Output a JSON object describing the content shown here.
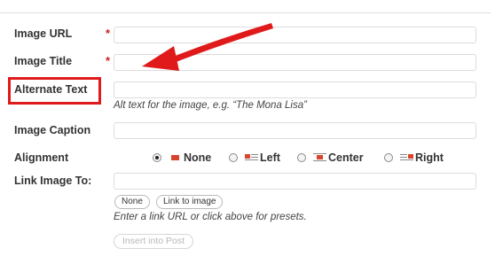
{
  "form": {
    "image_url": {
      "label": "Image URL",
      "required_mark": "*",
      "value": ""
    },
    "image_title": {
      "label": "Image Title",
      "required_mark": "*",
      "value": ""
    },
    "alternate_text": {
      "label": "Alternate Text",
      "value": "",
      "help": "Alt text for the image, e.g. “The Mona Lisa”"
    },
    "image_caption": {
      "label": "Image Caption",
      "value": ""
    },
    "alignment": {
      "label": "Alignment",
      "selected": "None",
      "options": [
        {
          "label": "None",
          "icon": "align-none-icon"
        },
        {
          "label": "Left",
          "icon": "align-left-icon"
        },
        {
          "label": "Center",
          "icon": "align-center-icon"
        },
        {
          "label": "Right",
          "icon": "align-right-icon"
        }
      ]
    },
    "link_image_to": {
      "label": "Link Image To:",
      "value": "",
      "buttons": {
        "none": "None",
        "link_to_image": "Link to image"
      },
      "help": "Enter a link URL or click above for presets."
    },
    "insert_button": "Insert into Post"
  },
  "annotation": {
    "highlight_color": "#e01a1a",
    "arrow_color": "#e01a1a"
  }
}
